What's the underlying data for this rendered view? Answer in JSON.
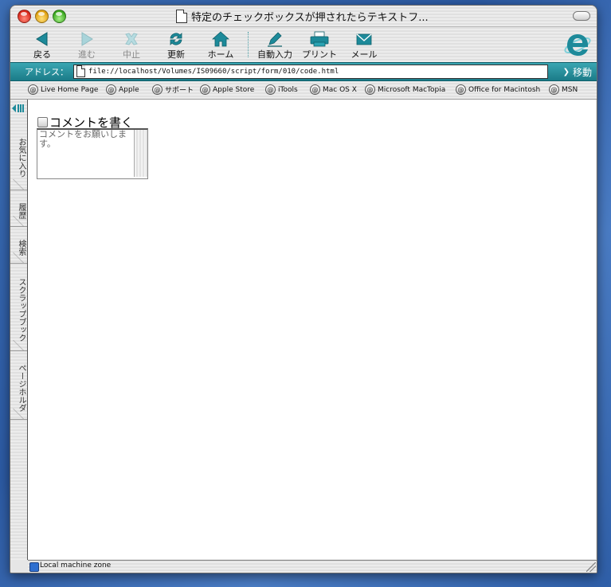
{
  "window": {
    "title": "特定のチェックボックスが押されたらテキストフ..."
  },
  "toolbar": {
    "back": "戻る",
    "forward": "進む",
    "stop": "中止",
    "refresh": "更新",
    "home": "ホーム",
    "autofill": "自動入力",
    "print": "プリント",
    "mail": "メール"
  },
  "address": {
    "label": "アドレス：",
    "url": "file://localhost/Volumes/IS09660/script/form/010/code.html",
    "go_label": "移動"
  },
  "favorites": [
    "Live Home Page",
    "Apple",
    "サポート",
    "Apple Store",
    "iTools",
    "Mac OS X",
    "Microsoft MacTopia",
    "Office for Macintosh",
    "MSN"
  ],
  "side_tabs": [
    "お気に入り",
    "履歴",
    "検索",
    "スクラップブック",
    "ページホルダ"
  ],
  "page": {
    "checkbox_label": "コメントを書く",
    "textarea_value": "コメントをお願いします。"
  },
  "status": {
    "zone": "Local machine zone"
  },
  "colors": {
    "accent": "#1b7b88",
    "icon_teal": "#1d8a9a"
  }
}
